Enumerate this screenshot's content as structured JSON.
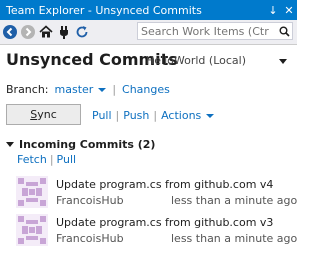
{
  "window": {
    "title": "Team Explorer - Unsynced Commits",
    "pin_glyph": "↓",
    "close_glyph": "✕"
  },
  "toolbar": {
    "search_placeholder": "Search Work Items (Ctr"
  },
  "page": {
    "title": "Unsynced Commits",
    "repo": "HelloWorld (Local)"
  },
  "branch": {
    "label": "Branch:",
    "value": "master",
    "changes_link": "Changes"
  },
  "sync_actions": {
    "sync_label_access_key": "S",
    "sync_label_rest": "ync",
    "pull": "Pull",
    "push": "Push",
    "actions": "Actions"
  },
  "incoming": {
    "header": "Incoming Commits (2)",
    "fetch": "Fetch",
    "pull": "Pull",
    "commits": [
      {
        "message": "Update program.cs from github.com v4",
        "author": "FrancoisHub",
        "time": "less than a minute ago"
      },
      {
        "message": "Update program.cs from github.com v3",
        "author": "FrancoisHub",
        "time": "less than a minute ago"
      }
    ]
  },
  "colors": {
    "accent": "#007acc",
    "link": "#0e70c0",
    "avatar": "#c8a5d6"
  }
}
